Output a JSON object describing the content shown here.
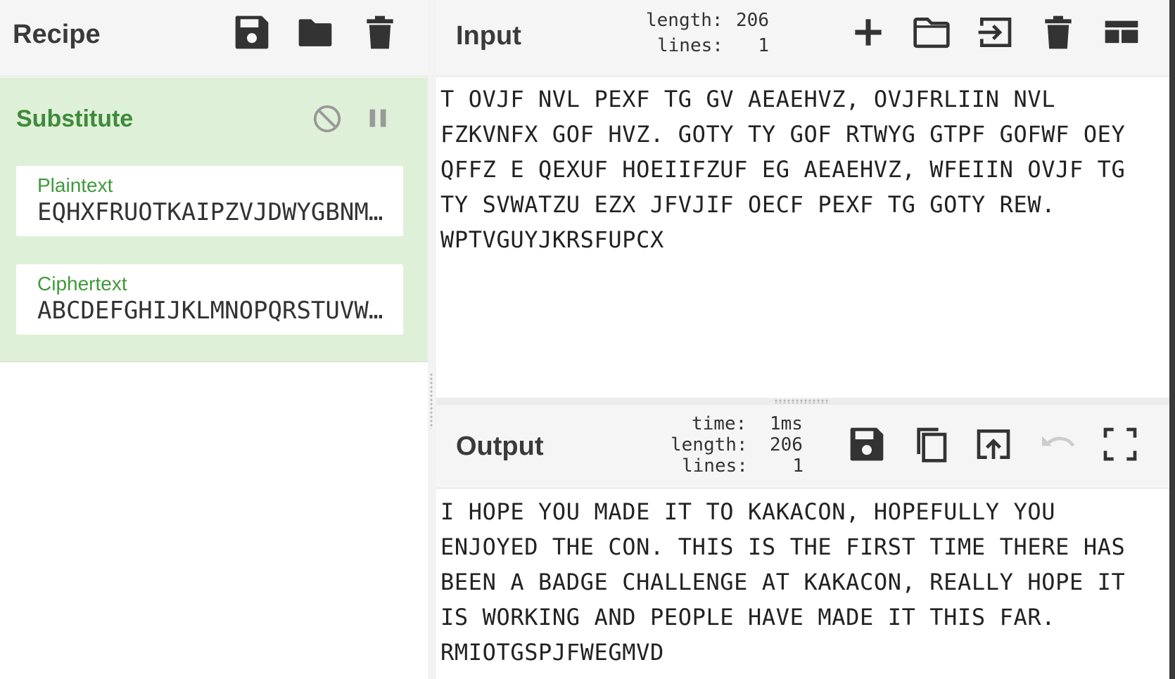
{
  "recipe": {
    "title": "Recipe",
    "icons": [
      "save-icon",
      "folder-icon",
      "trash-icon"
    ]
  },
  "operation": {
    "name": "Substitute",
    "icons": [
      "disable-icon",
      "pause-icon"
    ],
    "args": [
      {
        "label": "Plaintext",
        "value": "EQHXFRUOTKAIPZVJDWYGBNMSCL"
      },
      {
        "label": "Ciphertext",
        "value": "ABCDEFGHIJKLMNOPQRSTUVWXYZ"
      }
    ]
  },
  "input": {
    "title": "Input",
    "stats": {
      "length_label": "length:",
      "length": "206",
      "lines_label": "lines:",
      "lines": "1"
    },
    "icons": [
      "plus-icon",
      "folder-open-icon",
      "import-icon",
      "trash-icon",
      "layout-icon"
    ],
    "text": "T OVJF NVL PEXF TG GV AEAEHVZ, OVJFRLIIN NVL\nFZKVNFX GOF HVZ. GOTY TY GOF RTWYG GTPF GOFWF OEY\nQFFZ E QEXUF HOEIIFZUF EG AEAEHVZ, WFEIIN OVJF TG\nTY SVWATZU EZX JFVJIF OECF PEXF TG GOTY REW.\nWPTVGUYJKRSFUPCX"
  },
  "output": {
    "title": "Output",
    "stats": {
      "time_label": "time:",
      "time": "1ms",
      "length_label": "length:",
      "length": "206",
      "lines_label": "lines:",
      "lines": "1"
    },
    "icons": [
      "save-icon",
      "copy-icon",
      "replace-input-icon",
      "undo-icon",
      "fullscreen-icon"
    ],
    "text": "I HOPE YOU MADE IT TO KAKACON, HOPEFULLY YOU\nENJOYED THE CON. THIS IS THE FIRST TIME THERE HAS\nBEEN A BADGE CHALLENGE AT KAKACON, REALLY HOPE IT\nIS WORKING AND PEOPLE HAVE MADE IT THIS FAR.\nRMIOTGSPJFWEGMVD"
  },
  "colors": {
    "accent_green": "#3f8a3a",
    "card_bg": "#dff0d8",
    "header_bg": "#f5f5f5"
  }
}
